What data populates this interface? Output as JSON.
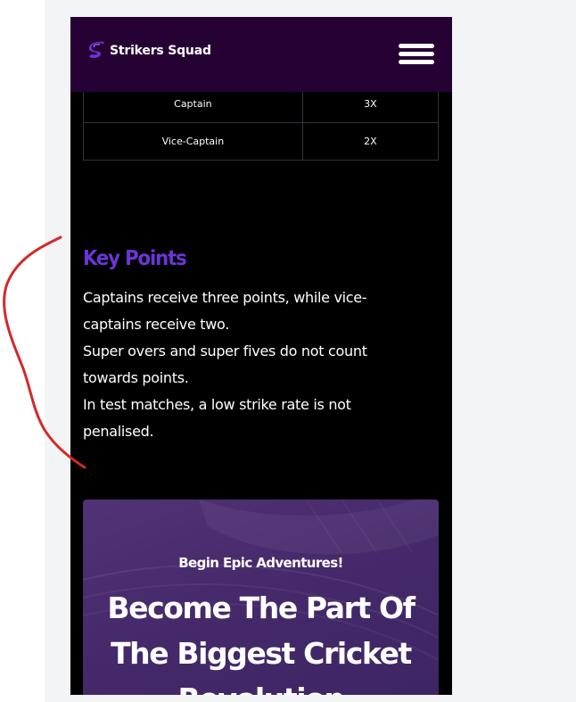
{
  "header": {
    "brand": "Strikers Squad",
    "logo_icon": "brand-s-logo-icon",
    "menu_icon": "hamburger-menu-icon",
    "background": "#260133"
  },
  "points_table": {
    "rows": [
      {
        "role": "Captain",
        "multiplier": "3X"
      },
      {
        "role": "Vice-Captain",
        "multiplier": "2X"
      }
    ]
  },
  "key_points": {
    "title": "Key Points",
    "title_color": "#6b35d6",
    "items": [
      "Captains receive three points, while vice-captains receive two.",
      "Super overs and super fives do not count towards points.",
      "In test matches, a low strike rate is not penalised."
    ]
  },
  "promo": {
    "kicker": "Begin Epic Adventures!",
    "heading": "Become The Part Of The Biggest Cricket Revolution",
    "background": "#4a2d6e"
  },
  "annotation": {
    "color": "#d4282a"
  }
}
